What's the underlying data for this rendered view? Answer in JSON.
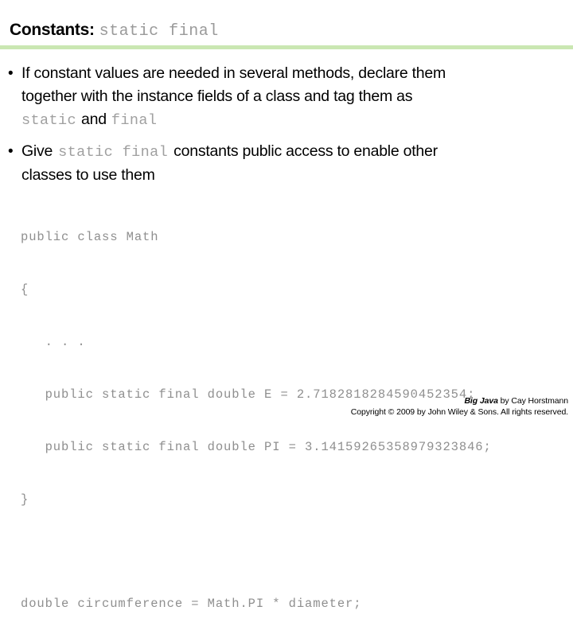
{
  "slide": {
    "title": {
      "main": "Constants:",
      "code": "static final"
    },
    "divider_color": "#cae7b2",
    "code_text_color": "#8f8f8f",
    "body_text_color": "#000000",
    "bullets": [
      {
        "marker": "•",
        "segments": [
          {
            "type": "text",
            "value": "If constant values are needed in several methods, declare them together with the instance fields of a class and tag them as "
          },
          {
            "type": "code",
            "value": "static"
          },
          {
            "type": "text",
            "value": " and "
          },
          {
            "type": "code",
            "value": "final"
          }
        ],
        "line_1_text": "If constant values are needed in several methods, declare them",
        "line_2_text": "together with the instance fields of a class and tag them as",
        "line_3_code_a": "static",
        "line_3_text": "and",
        "line_3_code_b": "final"
      },
      {
        "marker": "•",
        "segments": [
          {
            "type": "text",
            "value": "Give "
          },
          {
            "type": "code",
            "value": "static final"
          },
          {
            "type": "text",
            "value": " constants public access to enable other classes to use them"
          }
        ],
        "line_1_text_a": "Give",
        "line_1_code": "static final",
        "line_1_text_b": "constants public access to enable other",
        "line_2_text": "classes to use them"
      }
    ],
    "code_sample": {
      "lines": [
        "public class Math",
        "{",
        "   . . .",
        "   public static final double E = 2.7182818284590452354;",
        "   public static final double PI = 3.14159265358979323846;",
        "}",
        "",
        "double circumference = Math.PI * diameter;"
      ],
      "line_0": "public class Math",
      "line_1": "{",
      "line_2": "   . . .",
      "line_3": "   public static final double E = 2.7182818284590452354;",
      "line_4": "   public static final double PI = 3.14159265358979323846;",
      "line_5": "}",
      "line_6": "",
      "line_7": "double circumference = Math.PI * diameter;"
    },
    "footer": {
      "book_title": "Big Java",
      "byline": " by Cay Horstmann",
      "copyright": "Copyright © 2009 by John Wiley & Sons.  All rights reserved."
    }
  }
}
